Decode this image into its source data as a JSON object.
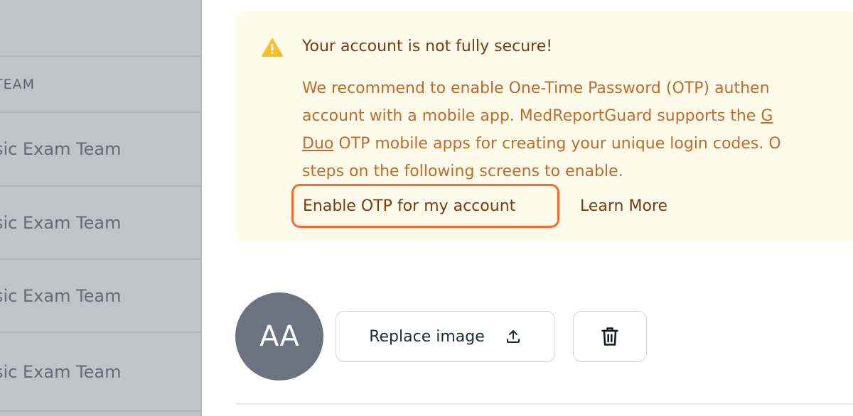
{
  "table": {
    "header": "TEAM",
    "rows": [
      "sic Exam Team",
      "sic Exam Team",
      "sic Exam Team",
      "sic Exam Team"
    ]
  },
  "alert": {
    "icon": "warning-triangle-icon",
    "title": "Your account is not fully secure!",
    "lines": [
      {
        "text": "We recommend to enable One-Time Password (OTP) authen"
      },
      {
        "pre": "account with a mobile app. MedReportGuard supports the ",
        "link": "G"
      },
      {
        "link": "Duo",
        "post": " OTP mobile apps for creating your unique login codes. O"
      },
      {
        "text": "steps on the following screens to enable."
      }
    ],
    "enable_button": "Enable OTP for my account",
    "learn_more": "Learn More",
    "colors": {
      "background": "#fefbeb",
      "highlight": "#f26a2e",
      "text": "#c06a2c",
      "title": "#7a3a14"
    }
  },
  "profile": {
    "avatar_initials": "AA",
    "replace_button": "Replace image",
    "replace_icon": "upload-icon",
    "delete_icon": "trash-icon"
  }
}
